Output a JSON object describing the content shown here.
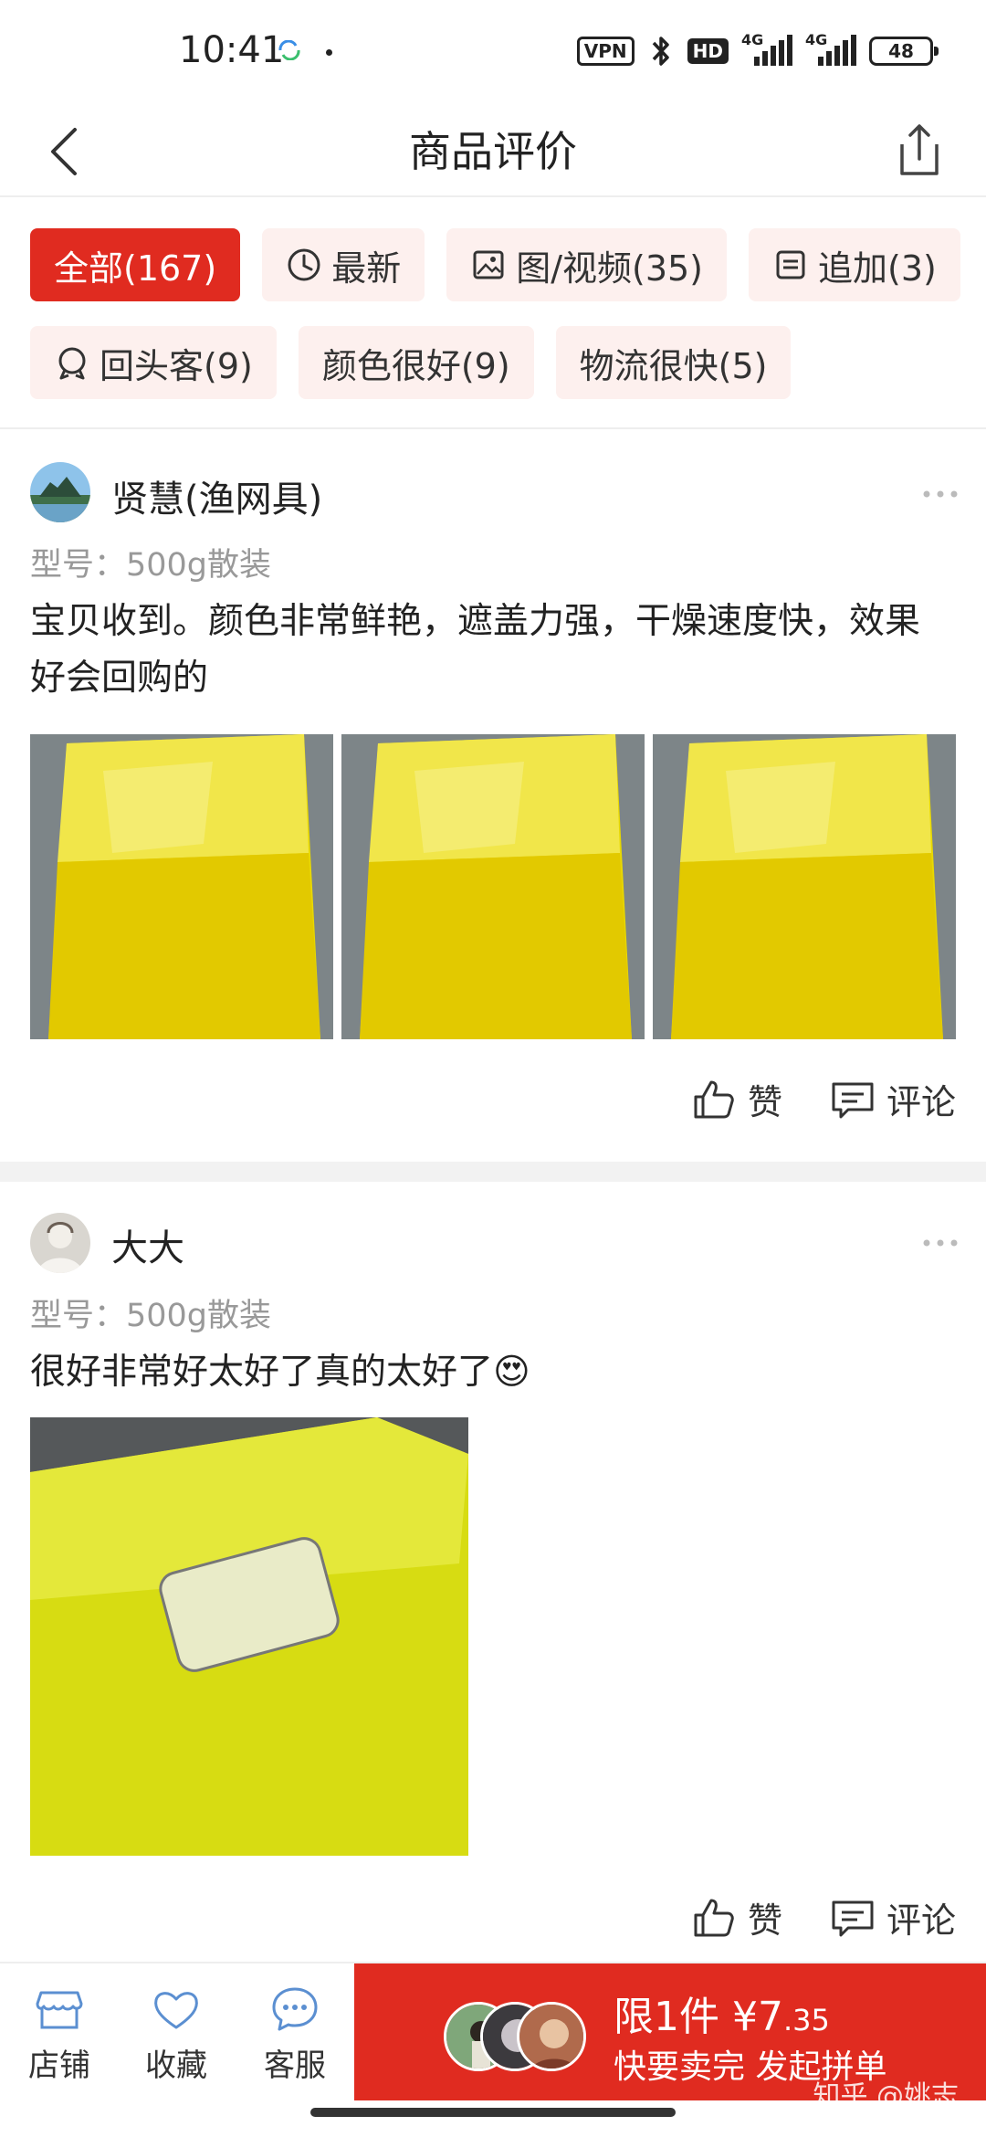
{
  "status_bar": {
    "time": "10:41",
    "vpn": "VPN",
    "hd": "HD",
    "net1": "4G",
    "net2": "4G",
    "battery": "48",
    "icons": [
      "sync-icon",
      "bluetooth-icon",
      "signal-icon",
      "battery-icon"
    ]
  },
  "nav": {
    "title": "商品评价",
    "back_icon": "chevron-left-icon",
    "share_icon": "share-icon"
  },
  "filters": [
    {
      "label": "全部(167)",
      "active": true,
      "icon": ""
    },
    {
      "label": "最新",
      "active": false,
      "icon": "clock-icon"
    },
    {
      "label": "图/视频(35)",
      "active": false,
      "icon": "image-icon"
    },
    {
      "label": "追加(3)",
      "active": false,
      "icon": "note-icon"
    },
    {
      "label": "回头客(9)",
      "active": false,
      "icon": "badge-icon"
    },
    {
      "label": "颜色很好(9)",
      "active": false,
      "icon": ""
    },
    {
      "label": "物流很快(5)",
      "active": false,
      "icon": ""
    }
  ],
  "reviews": [
    {
      "user": "贤慧(渔网具)",
      "model": "型号：500g散装",
      "text": "宝贝收到。颜色非常鲜艳，遮盖力强，干燥速度快，效果好会回购的",
      "like_label": "赞",
      "comment_label": "评论"
    },
    {
      "user": "大大",
      "model": "型号：500g散装",
      "text": "很好非常好太好了真的太好了😍",
      "like_label": "赞",
      "comment_label": "评论"
    }
  ],
  "bottom_bar": {
    "shop_label": "店铺",
    "favorite_label": "收藏",
    "service_label": "客服",
    "buy_line1_prefix": "限1件 ¥7",
    "buy_line1_suffix": ".35",
    "buy_line2": "快要卖完 发起拼单"
  },
  "watermark": "知乎 @姚志",
  "colors": {
    "accent": "#e02b20",
    "tag_bg": "#fdf0ee",
    "muted_text": "#999999"
  }
}
